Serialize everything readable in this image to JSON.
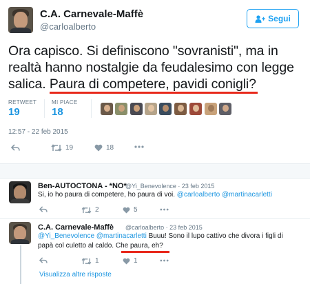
{
  "tweet": {
    "author": "C.A. Carnevale-Maffè",
    "handle": "@carloalberto",
    "follow_label": "Segui",
    "text_line1": "Ora capisco. Si definiscono \"sovranisti\", ma in",
    "text_line2": "realtà hanno nostalgie da feudalesimo con legge",
    "text_line3_a": "salica. ",
    "text_line3_b": "Paura di competere, pavidi conigli?",
    "retweet_label": "RETWEET",
    "retweet_count": "19",
    "likes_label": "MI PIACE",
    "likes_count": "18",
    "timestamp": "12:57 - 22 feb 2015",
    "actions": {
      "retweets": "19",
      "likes": "18"
    }
  },
  "replies": [
    {
      "name": "Ben-AUTOCTONA - *NO*",
      "handle": "@Yi_Benevolence",
      "date": "23 feb 2015",
      "text": "Si, io ho paura di competere, ho paura di voi.",
      "mention1": "@carloalberto",
      "mention2": "@martinacarletti",
      "retweets": "2",
      "likes": "5"
    },
    {
      "name": "C.A. Carnevale-Maffè",
      "handle": "@carloalberto",
      "date": "23 feb 2015",
      "mention1": "@Yi_Benevolence",
      "mention2": "@martinacarletti",
      "text_a": "Buuu! Sono il lupo cattivo che divora i figli di",
      "text_b": "papà col culetto al caldo. ",
      "text_c": "Che paura, eh?",
      "retweets": "1",
      "likes": "1"
    }
  ],
  "show_more": "Visualizza altre risposte",
  "colors": {
    "accent": "#1da1f2",
    "link": "#1b95e0",
    "underline": "#e8291c",
    "muted": "#657786"
  }
}
